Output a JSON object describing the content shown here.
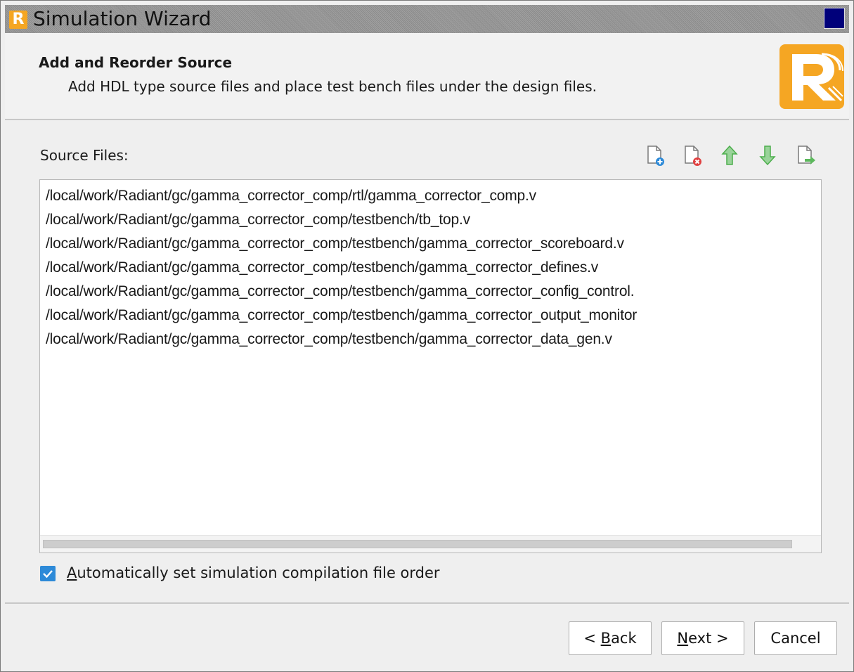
{
  "window": {
    "title": "Simulation Wizard",
    "logo_letter": "R"
  },
  "header": {
    "title": "Add and Reorder Source",
    "description": "Add HDL type source files and place test bench files under the design files."
  },
  "source_files": {
    "label": "Source Files:",
    "files": [
      "/local/work/Radiant/gc/gamma_corrector_comp/rtl/gamma_corrector_comp.v",
      "/local/work/Radiant/gc/gamma_corrector_comp/testbench/tb_top.v",
      "/local/work/Radiant/gc/gamma_corrector_comp/testbench/gamma_corrector_scoreboard.v",
      "/local/work/Radiant/gc/gamma_corrector_comp/testbench/gamma_corrector_defines.v",
      "/local/work/Radiant/gc/gamma_corrector_comp/testbench/gamma_corrector_config_control.",
      "/local/work/Radiant/gc/gamma_corrector_comp/testbench/gamma_corrector_output_monitor",
      "/local/work/Radiant/gc/gamma_corrector_comp/testbench/gamma_corrector_data_gen.v"
    ],
    "toolbar_icons": [
      "add-file-icon",
      "remove-file-icon",
      "move-up-icon",
      "move-down-icon",
      "export-file-icon"
    ]
  },
  "options": {
    "auto_order_checked": true,
    "auto_order_mnemonic": "A",
    "auto_order_rest": "utomatically set simulation compilation file order"
  },
  "buttons": {
    "back_prefix": "< ",
    "back_mnemonic": "B",
    "back_rest": "ack",
    "next_mnemonic": "N",
    "next_rest": "ext >",
    "cancel": "Cancel"
  },
  "colors": {
    "brand": "#f5a623",
    "checkbox": "#2d8ad8",
    "arrow_green": "#5cb85c",
    "add_blue": "#2d8ad8",
    "remove_red": "#e04040"
  }
}
